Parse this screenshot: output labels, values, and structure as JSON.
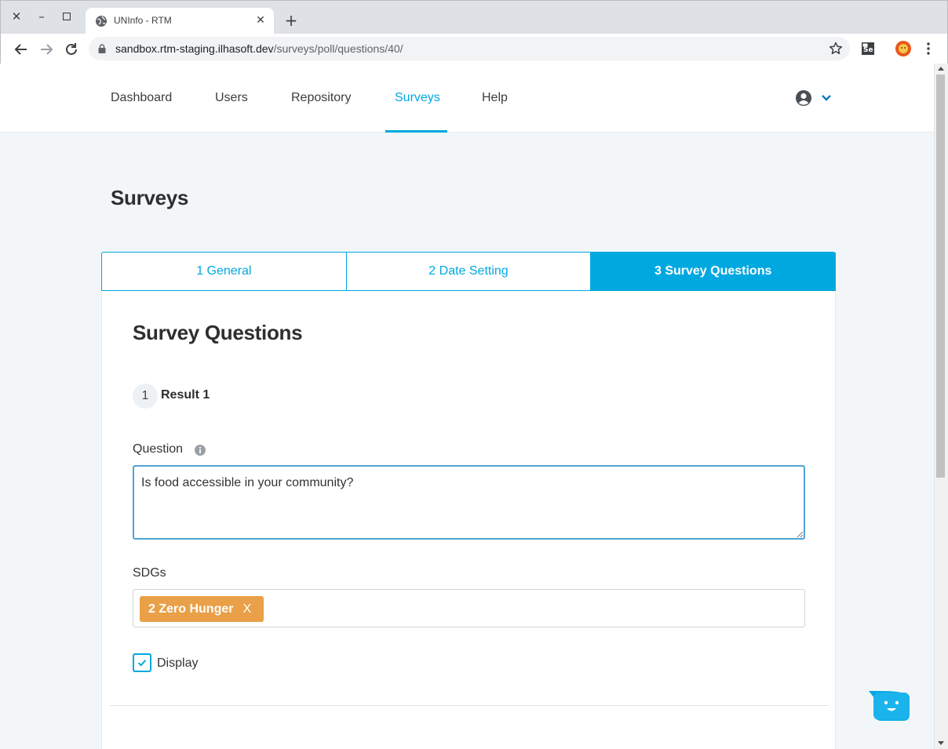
{
  "browser": {
    "tab_title": "UNInfo - RTM",
    "url_host": "sandbox.rtm-staging.ilhasoft.dev",
    "url_path": "/surveys/poll/questions/40/",
    "ext_label": "Se"
  },
  "nav": {
    "items": [
      "Dashboard",
      "Users",
      "Repository",
      "Surveys",
      "Help"
    ],
    "active": "Surveys"
  },
  "page": {
    "title": "Surveys"
  },
  "steps": [
    {
      "label": "1 General",
      "active": false
    },
    {
      "label": "2 Date Setting",
      "active": false
    },
    {
      "label": "3 Survey Questions",
      "active": true
    }
  ],
  "form": {
    "title": "Survey Questions",
    "question_number": "1",
    "question_title": "Result 1",
    "question_label": "Question",
    "question_value": "Is food accessible in your community?",
    "sdgs_label": "SDGs",
    "sdg_chip": "2 Zero Hunger",
    "sdg_chip_remove": "X",
    "display_label": "Display",
    "display_checked": true
  },
  "colors": {
    "accent": "#00a8e0",
    "chip": "#e9a048",
    "page_bg": "#f2f6f8"
  }
}
